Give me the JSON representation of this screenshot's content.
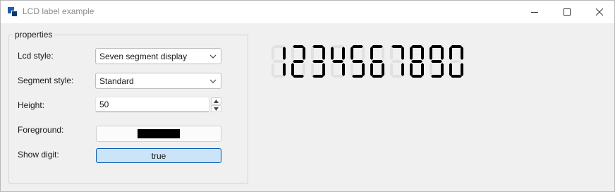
{
  "window": {
    "title": "LCD label example",
    "minimize_icon": "minimize-icon",
    "maximize_icon": "maximize-icon",
    "close_icon": "close-icon"
  },
  "properties": {
    "group_label": "properties",
    "lcd_style": {
      "label": "Lcd style:",
      "value": "Seven segment display"
    },
    "segment_style": {
      "label": "Segment style:",
      "value": "Standard"
    },
    "height": {
      "label": "Height:",
      "value": "50"
    },
    "foreground": {
      "label": "Foreground:",
      "color": "#000000"
    },
    "show_digit": {
      "label": "Show digit:",
      "value": "true"
    }
  },
  "lcd": {
    "text": "1234567890",
    "on_color": "#000000",
    "ghost_color": "#e1e1e1"
  },
  "colors": {
    "window_bg": "#f0f0f0",
    "titlebar_bg": "#ffffff",
    "toggle_bg": "#cce4f7",
    "toggle_border": "#0056b3"
  }
}
